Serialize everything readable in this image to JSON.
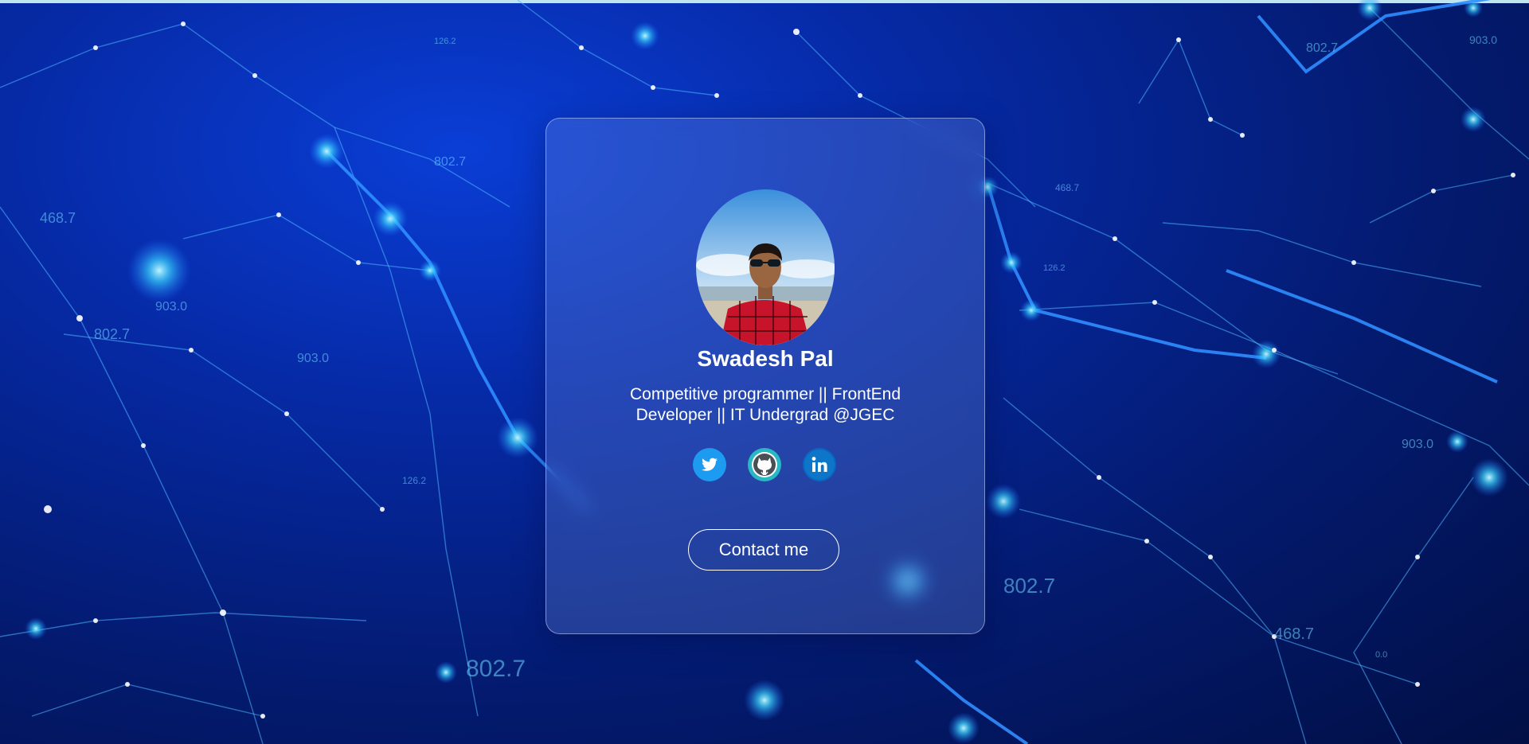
{
  "profile": {
    "name": "Swadesh Pal",
    "tagline": "Competitive programmer || FrontEnd Developer || IT Undergrad @JGEC",
    "avatar_icon": "profile-photo"
  },
  "socials": [
    {
      "icon": "twitter-icon",
      "color": "#1d9bf0"
    },
    {
      "icon": "github-icon",
      "color": "#2ab7c4"
    },
    {
      "icon": "linkedin-icon",
      "color": "#0a66c2"
    }
  ],
  "contact": {
    "label": "Contact me"
  },
  "background": {
    "labels": [
      "802.7",
      "126.2",
      "903.0",
      "468.7",
      "0.0"
    ]
  },
  "colors": {
    "background": "#031a6e",
    "accent": "#3ad4ff",
    "card_border": "#c8d7ff"
  }
}
